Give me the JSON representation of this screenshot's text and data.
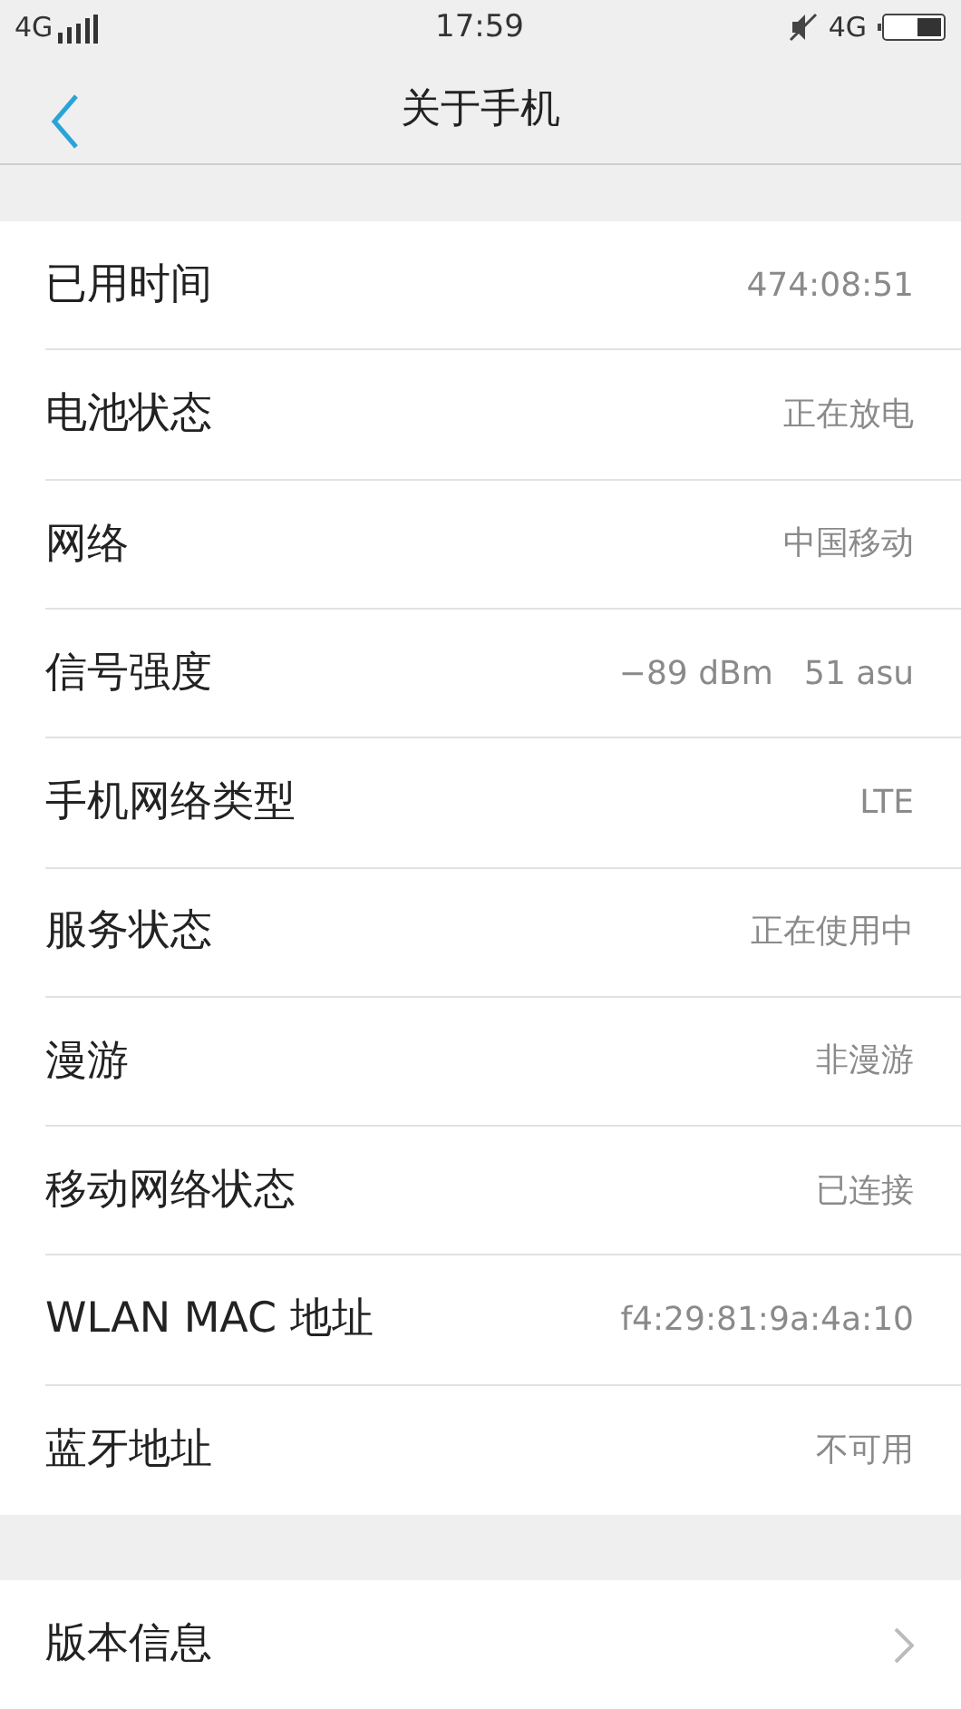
{
  "status_bar": {
    "network": "4G",
    "time": "17:59",
    "network_right": "4G"
  },
  "header": {
    "title": "关于手机"
  },
  "rows": [
    {
      "label": "已用时间",
      "value": "474:08:51"
    },
    {
      "label": "电池状态",
      "value": "正在放电"
    },
    {
      "label": "网络",
      "value": "中国移动"
    },
    {
      "label": "信号强度",
      "value": "−89 dBm   51 asu"
    },
    {
      "label": "手机网络类型",
      "value": "LTE"
    },
    {
      "label": "服务状态",
      "value": "正在使用中"
    },
    {
      "label": "漫游",
      "value": "非漫游"
    },
    {
      "label": "移动网络状态",
      "value": "已连接"
    },
    {
      "label": "WLAN MAC 地址",
      "value": "f4:29:81:9a:4a:10"
    },
    {
      "label": "蓝牙地址",
      "value": "不可用"
    }
  ],
  "link_rows": [
    {
      "label": "版本信息"
    }
  ]
}
